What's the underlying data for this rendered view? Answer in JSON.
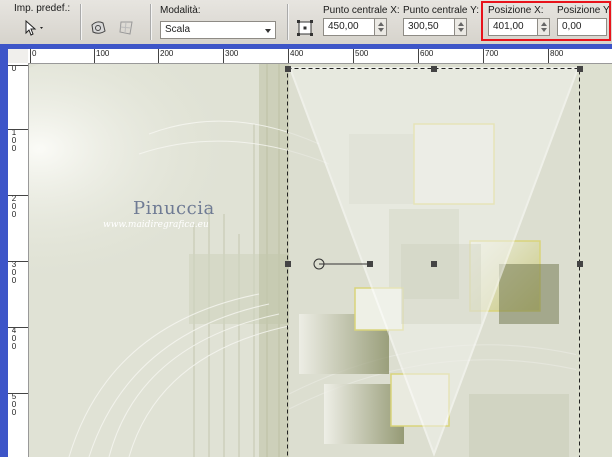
{
  "toolbar": {
    "preset_label": "Imp. predef.:",
    "mode_label": "Modalità:",
    "mode_value": "Scala",
    "center_x_label": "Punto centrale X:",
    "center_x_value": "450,00",
    "center_y_label": "Punto centrale Y:",
    "center_y_value": "300,50",
    "pos_x_label": "Posizione X:",
    "pos_x_value": "401,00",
    "pos_y_label": "Posizione Y:",
    "pos_y_value": "0,00"
  },
  "rulers": {
    "horizontal": [
      "0",
      "100",
      "200",
      "300",
      "400",
      "500",
      "600",
      "700",
      "800"
    ],
    "vertical": [
      "0",
      "1\n0\n0",
      "2\n0\n0",
      "3\n0\n0",
      "4\n0\n0",
      "5\n0\n0"
    ]
  },
  "watermark": {
    "name": "Pinuccia",
    "url": "www.maidiregrafica.eu"
  },
  "colors": {
    "highlight_box": "#e8131b",
    "canvas_border": "#3d55c8",
    "tube_yellow": "#d9d47a",
    "tube_olive": "#6b7248"
  },
  "icons": [
    "pick-tool-icon",
    "deform-tool-icon",
    "mesh-tool-icon",
    "apply-center-icon"
  ]
}
